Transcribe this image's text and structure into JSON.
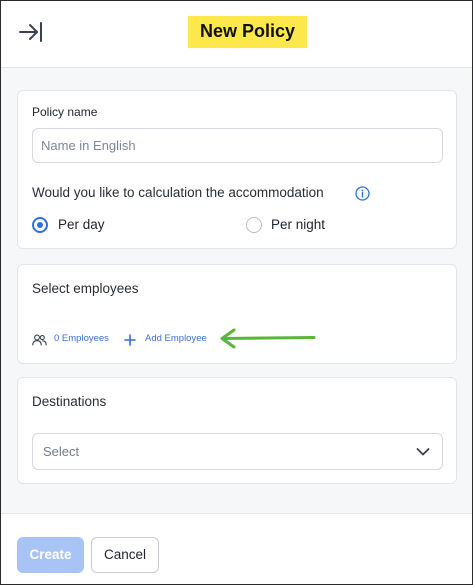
{
  "header": {
    "title": "New Policy",
    "collapse_icon": "collapse-to-right-icon",
    "title_highlight": "#fce84a"
  },
  "policy": {
    "name_label": "Policy name",
    "name_placeholder": "Name in English",
    "name_value": "",
    "question": "Would you like to calculation the accommodation",
    "info_icon": "info-icon",
    "options": [
      {
        "label": "Per day",
        "selected": true
      },
      {
        "label": "Per night",
        "selected": false
      }
    ]
  },
  "employees": {
    "title": "Select employees",
    "count_label": "0 Employees",
    "people_icon": "people-icon",
    "add_icon": "plus-icon",
    "add_label": "Add Employee",
    "annotation_arrow_color": "#5bb53a"
  },
  "destinations": {
    "title": "Destinations",
    "select_placeholder": "Select",
    "chevron_icon": "chevron-down-icon"
  },
  "footer": {
    "create_label": "Create",
    "cancel_label": "Cancel"
  },
  "colors": {
    "accent": "#2f6fe0",
    "link": "#3d6fd6",
    "create_disabled": "#a8c4f6"
  }
}
